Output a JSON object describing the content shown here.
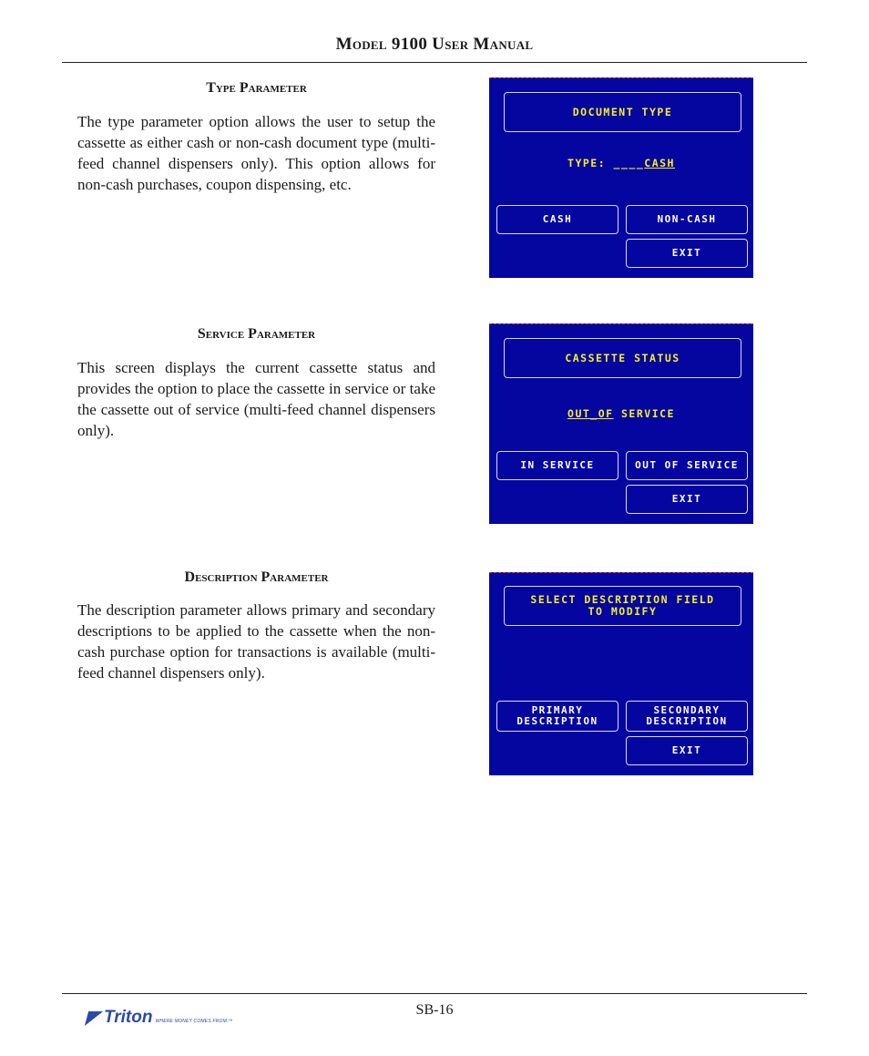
{
  "header": {
    "title": "Model 9100 User Manual"
  },
  "sections": [
    {
      "heading": "Type Parameter",
      "body": "The type parameter option allows the user to setup the cassette as either cash or non-cash document type (multi-feed channel dispensers only).  This option allows for non-cash purchases, coupon dispensing, etc.",
      "screen": {
        "title_lines": [
          "DOCUMENT TYPE"
        ],
        "value_prefix": "TYPE: ____",
        "value_underlined": "CASH",
        "value_suffix": "",
        "buttons": {
          "left": [
            "CASH"
          ],
          "right": [
            "NON-CASH"
          ],
          "exit": "EXIT"
        }
      }
    },
    {
      "heading": "Service Parameter",
      "body": "This screen displays the current cassette status and provides the option to place the cassette in service or take the cassette out of service (multi-feed channel dispensers only).",
      "screen": {
        "title_lines": [
          "CASSETTE STATUS"
        ],
        "value_prefix": "",
        "value_underlined": "OUT_OF",
        "value_suffix": " SERVICE",
        "buttons": {
          "left": [
            "IN SERVICE"
          ],
          "right": [
            "OUT OF SERVICE"
          ],
          "exit": "EXIT"
        }
      }
    },
    {
      "heading": "Description Parameter",
      "body": "The description parameter allows primary and secondary descriptions to be applied to the cassette when the non-cash purchase option for transactions is available (multi-feed channel dispensers only).",
      "screen": {
        "title_lines": [
          "SELECT DESCRIPTION FIELD",
          "TO MODIFY"
        ],
        "buttons": {
          "left": [
            "PRIMARY",
            "DESCRIPTION"
          ],
          "right": [
            "SECONDARY",
            "DESCRIPTION"
          ],
          "exit": "EXIT"
        }
      }
    }
  ],
  "footer": {
    "page_number": "SB-16",
    "logo_text": "Triton",
    "logo_tagline": "WHERE MONEY COMES FROM.™"
  },
  "colors": {
    "screen_bg": "#0505a0",
    "screen_text": "#f5f020",
    "button_text": "#ffffff"
  }
}
